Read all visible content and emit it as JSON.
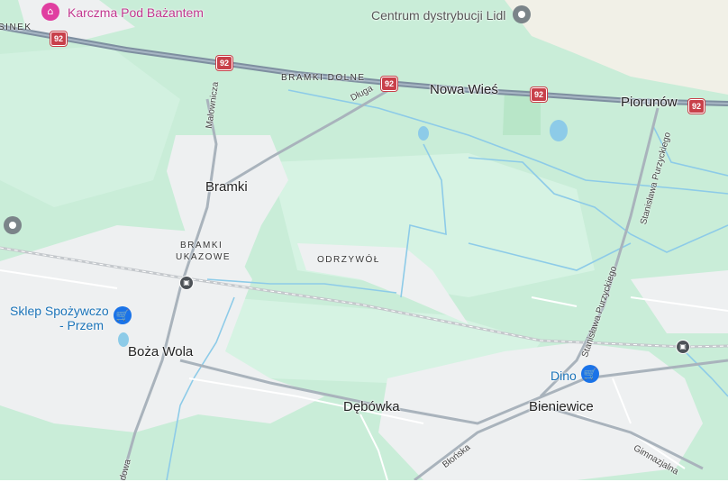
{
  "map": {
    "colors": {
      "forest": "#c7ecd6",
      "field": "#d4f2e1",
      "urban": "#eef0f1",
      "urban_ne": "#f1f0e7",
      "water": "#8dcbe8",
      "highway": "#8a9aaa",
      "road": "#ffffff",
      "rail": "#c4c8cc",
      "shield": "#c8404a"
    },
    "highway_shields": [
      {
        "label": "92"
      },
      {
        "label": "92"
      },
      {
        "label": "92"
      },
      {
        "label": "92"
      },
      {
        "label": "92"
      }
    ],
    "places": {
      "nowa_wies": "Nowa Wieś",
      "piorunow": "Piorunów",
      "bramki": "Bramki",
      "boza_wola": "Boża Wola",
      "debowka": "Dębówka",
      "bieniewice": "Bieniewice",
      "bramki_dolne": "BRAMKI DOLNE",
      "bramki_ukazowe_line1": "BRAMKI",
      "bramki_ukazowe_line2": "UKAZOWE",
      "odrzywol": "ODRZYWÓŁ",
      "sinek": "SINEK"
    },
    "streets": {
      "dluga": "Długa",
      "malownicza": "Malownicza",
      "stanislawa_purzyckiego": "Stanisława Purzyckiego",
      "blonska": "Błońska",
      "gimnazjalna": "Gimnazjalna",
      "dowa": "dowa"
    },
    "pois": {
      "karczma": {
        "name": "Karczma Pod Bażantem",
        "icon": "bed-icon"
      },
      "lidl": {
        "name": "Centrum dystrybucji Lidl",
        "icon": "place-pin-icon"
      },
      "sklep": {
        "name_line1": "Sklep Spożywczo",
        "name_line2": "- Przem",
        "icon": "shopping-cart-icon"
      },
      "dino": {
        "name": "Dino",
        "icon": "shopping-cart-icon"
      }
    },
    "stations": [
      {
        "icon": "train-station-icon"
      },
      {
        "icon": "train-station-icon"
      }
    ],
    "glyphs": {
      "cart": "🛒",
      "bed": "⌂",
      "train": "▣"
    }
  }
}
